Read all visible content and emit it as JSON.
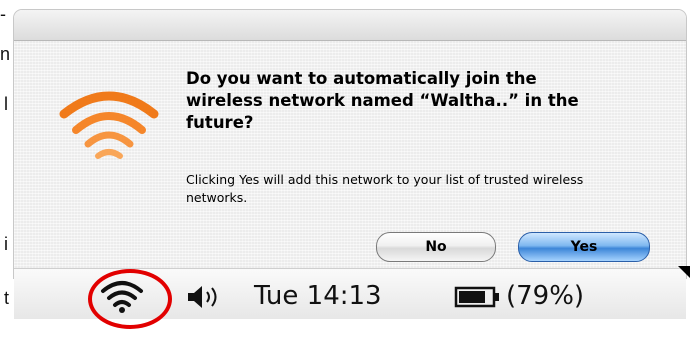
{
  "left_fragments": [
    "-",
    "n",
    "l",
    "i",
    "t"
  ],
  "dialog": {
    "question": "Do you want to automatically join the wireless network named “Waltha..” in the future?",
    "info": "Clicking Yes will add this network to your list of trusted wireless networks.",
    "no_label": "No",
    "yes_label": "Yes",
    "icon": "wifi-icon"
  },
  "menubar": {
    "clock": "Tue 14:13",
    "battery_percent": "(79%)",
    "icons": [
      "wifi-icon",
      "speaker-icon",
      "battery-icon"
    ]
  },
  "colors": {
    "wifi_orange": "#f07a1a",
    "highlight_circle": "#e20000",
    "default_button": "#3d86d8"
  }
}
